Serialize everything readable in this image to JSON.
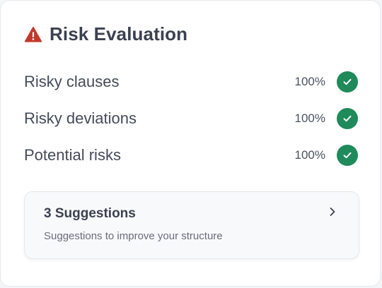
{
  "header": {
    "title": "Risk Evaluation",
    "icon": "warning-triangle-icon",
    "icon_color": "#c0392b"
  },
  "risks": [
    {
      "label": "Risky clauses",
      "value": "100%",
      "status": "check-circle-icon"
    },
    {
      "label": "Risky deviations",
      "value": "100%",
      "status": "check-circle-icon"
    },
    {
      "label": "Potential risks",
      "value": "100%",
      "status": "check-circle-icon"
    }
  ],
  "suggestions": {
    "title": "3 Suggestions",
    "subtitle": "Suggestions to improve your structure",
    "icon": "chevron-right-icon"
  },
  "colors": {
    "success": "#1f8a5a",
    "warning": "#c0392b"
  }
}
